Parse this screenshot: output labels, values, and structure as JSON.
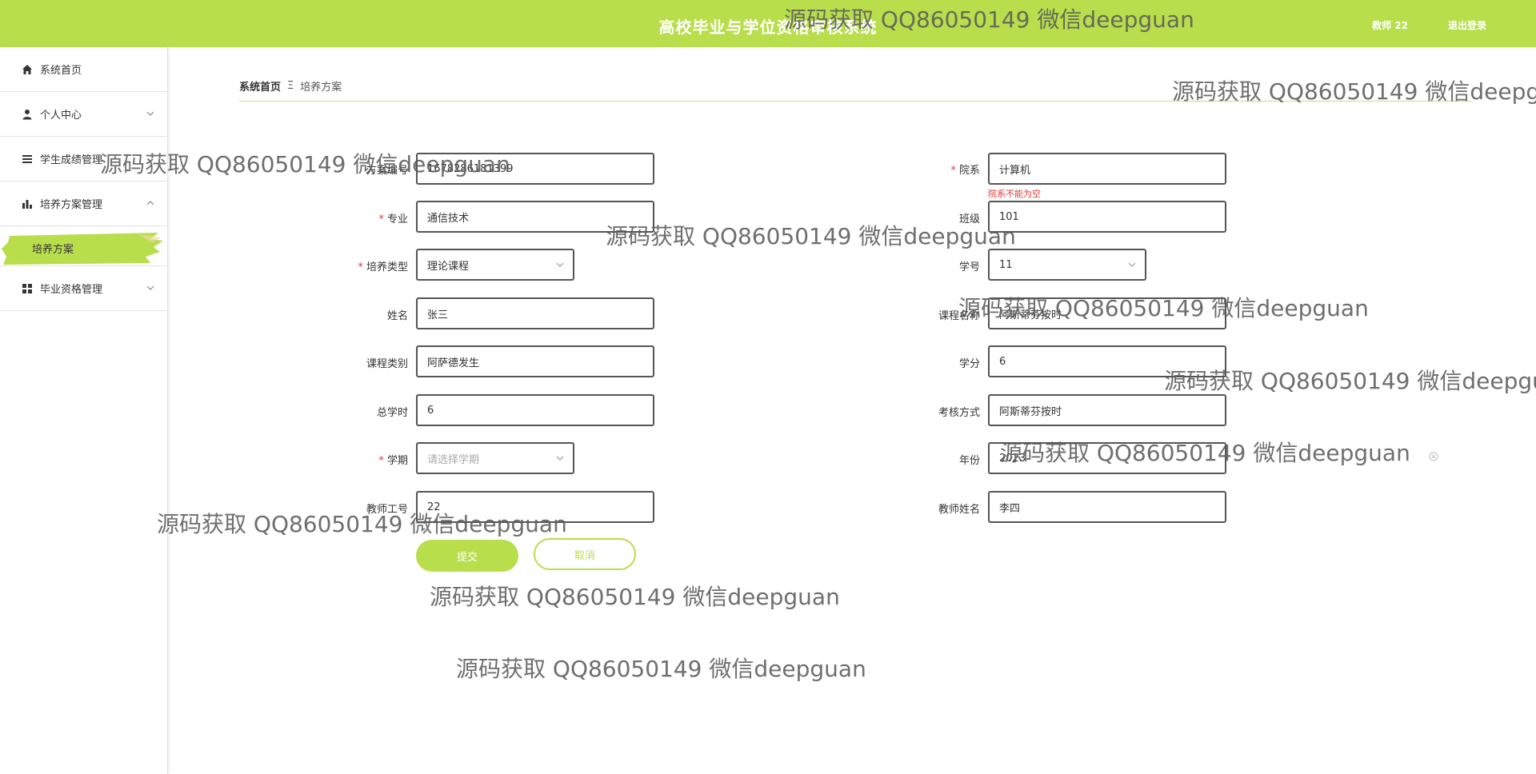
{
  "header": {
    "title": "高校毕业与学位资格审核系统",
    "user": "教师 22",
    "logout": "退出登录"
  },
  "sidebar": {
    "items": [
      {
        "label": "系统首页"
      },
      {
        "label": "个人中心"
      },
      {
        "label": "学生成绩管理"
      },
      {
        "label": "培养方案管理"
      },
      {
        "label": "培养方案"
      },
      {
        "label": "毕业资格管理"
      }
    ]
  },
  "breadcrumb": {
    "home": "系统首页",
    "separator": "Ξ",
    "current": "培养方案"
  },
  "form": {
    "plan_no": {
      "label": "方案编号",
      "value": "1678286181399"
    },
    "department": {
      "label": "院系",
      "value": "计算机",
      "error": "院系不能为空"
    },
    "major": {
      "label": "专业",
      "value": "通信技术"
    },
    "class": {
      "label": "班级",
      "value": "101"
    },
    "train_type": {
      "label": "培养类型",
      "value": "理论课程"
    },
    "student_no": {
      "label": "学号",
      "value": "11"
    },
    "name": {
      "label": "姓名",
      "value": "张三"
    },
    "course_name": {
      "label": "课程名称",
      "value": "阿斯蒂芬按时"
    },
    "course_category": {
      "label": "课程类别",
      "value": "阿萨德发生"
    },
    "credit": {
      "label": "学分",
      "value": "6"
    },
    "total_hours": {
      "label": "总学时",
      "value": "6"
    },
    "exam_method": {
      "label": "考核方式",
      "value": "阿斯蒂芬按时"
    },
    "semester": {
      "label": "学期",
      "placeholder": "请选择学期"
    },
    "year": {
      "label": "年份",
      "value": "2023"
    },
    "teacher_no": {
      "label": "教师工号",
      "value": "22"
    },
    "teacher_name": {
      "label": "教师姓名",
      "value": "李四"
    },
    "submit": "提交",
    "cancel": "取消"
  },
  "watermark": "源码获取 QQ86050149 微信deepguan",
  "colors": {
    "accent": "#b8de4c",
    "required": "#e53935"
  }
}
